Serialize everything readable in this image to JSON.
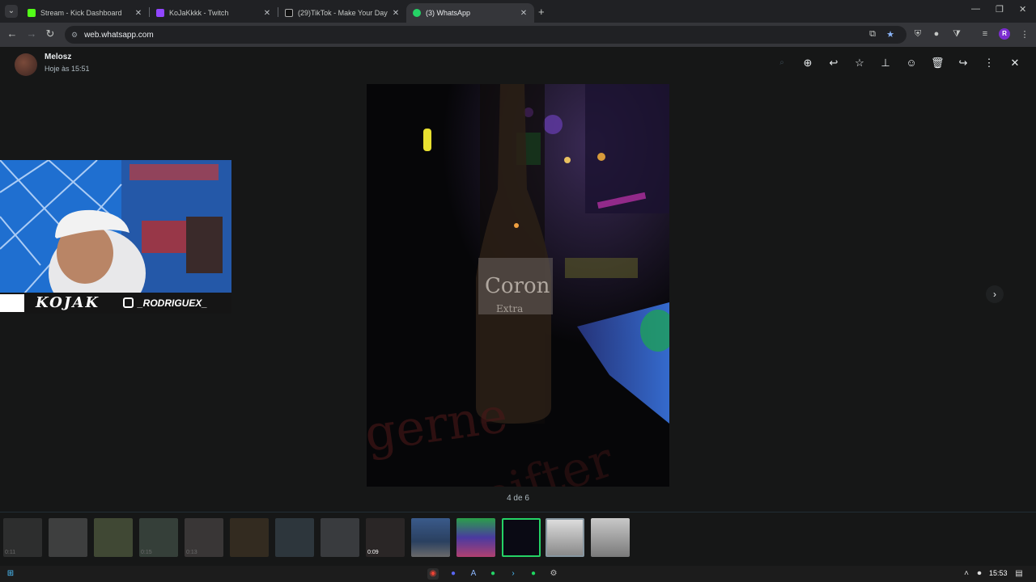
{
  "browser": {
    "tabs": [
      {
        "label": "Stream - Kick Dashboard",
        "fav_color": "#53fc18"
      },
      {
        "label": "KoJaKkkk - Twitch",
        "fav_color": "#9146ff"
      },
      {
        "label": "(29)TikTok - Make Your Day",
        "fav_color": "#111111"
      },
      {
        "label": "(3) WhatsApp",
        "fav_color": "#25d366"
      }
    ],
    "url": "web.whatsapp.com",
    "profile_initial": "R"
  },
  "viewer": {
    "sender": "Melosz",
    "sent_time": "Hoje às 15:51",
    "counter": "4 de 6",
    "header_icons": [
      "search-icon",
      "zoom-in-icon",
      "reply-icon",
      "star-icon",
      "pin-icon",
      "emoji-icon",
      "delete-icon",
      "forward-icon",
      "menu-icon",
      "close-icon"
    ]
  },
  "overlay": {
    "name": "KOJAK",
    "handle": "_RODRIGUEX_"
  },
  "thumbnails": [
    {
      "duration": "0:11"
    },
    {
      "duration": ""
    },
    {
      "duration": ""
    },
    {
      "duration": "0:15"
    },
    {
      "duration": "0:13"
    },
    {
      "duration": ""
    },
    {
      "duration": ""
    },
    {
      "duration": ""
    },
    {
      "duration": "0:09"
    },
    {
      "duration": ""
    },
    {
      "duration": ""
    },
    {
      "duration": ""
    },
    {
      "duration": ""
    },
    {
      "duration": ""
    }
  ],
  "taskbar": {
    "time": "15:53"
  }
}
